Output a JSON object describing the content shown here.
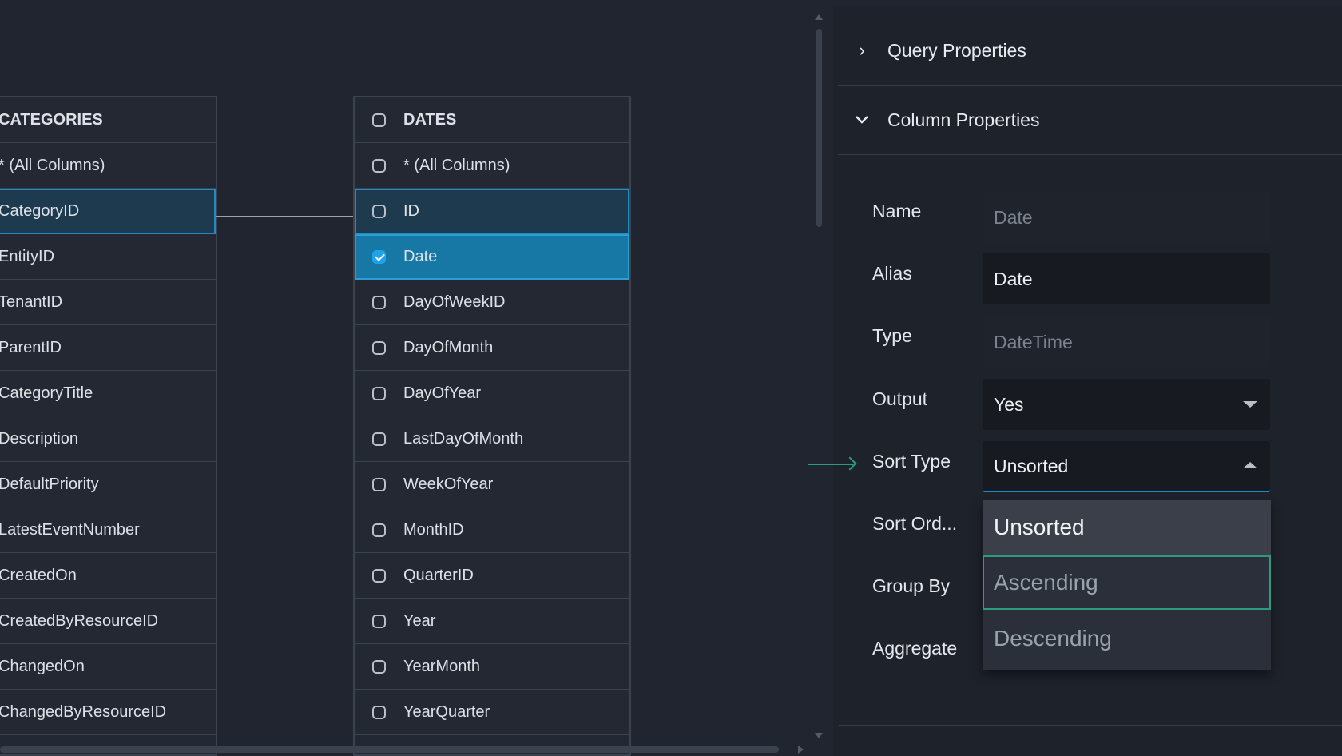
{
  "categories_table": {
    "header": "CATEGORIES",
    "rows": [
      "* (All Columns)",
      "CategoryID",
      "EntityID",
      "TenantID",
      "ParentID",
      "CategoryTitle",
      "Description",
      "DefaultPriority",
      "LatestEventNumber",
      "CreatedOn",
      "CreatedByResourceID",
      "ChangedOn",
      "ChangedByResourceID"
    ]
  },
  "dates_table": {
    "header": "DATES",
    "rows": [
      "* (All Columns)",
      "ID",
      "Date",
      "DayOfWeekID",
      "DayOfMonth",
      "DayOfYear",
      "LastDayOfMonth",
      "WeekOfYear",
      "MonthID",
      "QuarterID",
      "Year",
      "YearMonth",
      "YearQuarter"
    ],
    "checked": [
      "Date"
    ]
  },
  "panel": {
    "query_properties": "Query Properties",
    "column_properties": "Column Properties",
    "labels": {
      "name": "Name",
      "alias": "Alias",
      "type": "Type",
      "output": "Output",
      "sort_type": "Sort Type",
      "sort_order": "Sort Ord...",
      "group_by": "Group By",
      "aggregate": "Aggregate"
    },
    "values": {
      "name": "Date",
      "alias": "Date",
      "type": "DateTime",
      "output": "Yes",
      "sort_type": "Unsorted"
    },
    "sort_type_options": [
      "Unsorted",
      "Ascending",
      "Descending"
    ]
  },
  "colors": {
    "accent_blue": "#1f8cc6",
    "accent_green": "#2a9c7c",
    "background": "#21252f"
  },
  "icons": [
    "chevron-right-icon",
    "chevron-down-icon",
    "checkbox-icon",
    "dropdown-caret-icon",
    "arrow-right-icon"
  ]
}
